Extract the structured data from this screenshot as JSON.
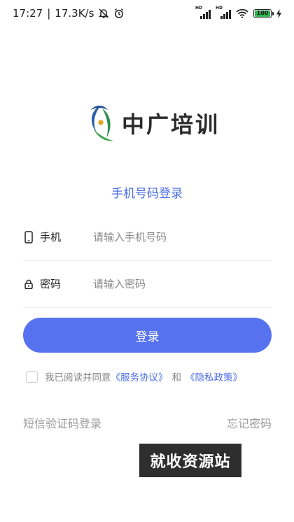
{
  "status_bar": {
    "time": "17:27",
    "separator": "|",
    "speed": "17.3K/s",
    "hd1": "HD",
    "hd2": "HD",
    "battery": "100"
  },
  "logo": {
    "text": "中广培训"
  },
  "login": {
    "subtitle": "手机号码登录",
    "phone_label": "手机",
    "phone_placeholder": "请输入手机号码",
    "password_label": "密码",
    "password_placeholder": "请输入密码",
    "submit_label": "登录"
  },
  "agreement": {
    "prefix": "我已阅读并同意",
    "service_link": "《服务协议》",
    "and": "和",
    "privacy_link": "《隐私政策》"
  },
  "links": {
    "sms_login": "短信验证码登录",
    "forgot_password": "忘记密码"
  },
  "watermark": {
    "text": "就收资源站"
  },
  "colors": {
    "accent": "#5672ee",
    "link": "#4b6ee5",
    "battery": "#2db552"
  }
}
